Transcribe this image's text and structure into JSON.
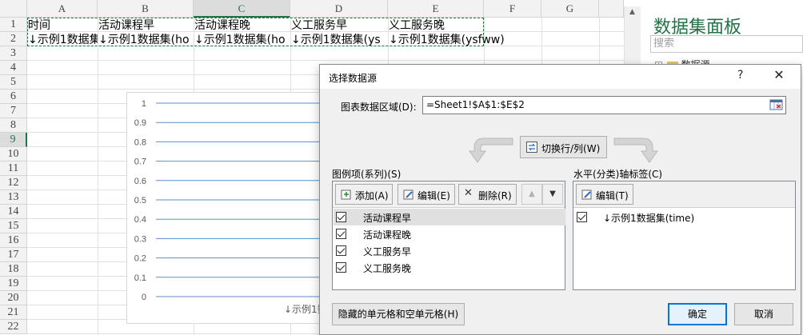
{
  "spreadsheet": {
    "columns": [
      "A",
      "B",
      "C",
      "D",
      "E",
      "F",
      "G"
    ],
    "selected_column": "C",
    "rows": [
      "1",
      "2",
      "3",
      "4",
      "5",
      "6",
      "7",
      "8",
      "9",
      "10",
      "11",
      "12",
      "13",
      "14",
      "15",
      "16",
      "17",
      "18",
      "19",
      "20",
      "21",
      "22"
    ],
    "selected_row": "9",
    "row1": [
      "时间",
      "活动课程早",
      "活动课程晚",
      "义工服务早",
      "义工服务晚"
    ],
    "row2": [
      "↓示例1数据集",
      "↓示例1数据集(ho",
      "↓示例1数据集(ho",
      "↓示例1数据集(ys",
      "↓示例1数据集(ysfww)"
    ]
  },
  "chart": {
    "y_ticks": [
      "1",
      "0.9",
      "0.8",
      "0.7",
      "0.6",
      "0.5",
      "0.4",
      "0.3",
      "0.2",
      "0.1",
      "0"
    ],
    "x_label": "↓示例1数",
    "gridline_color": "#5b8fc7"
  },
  "chart_data": {
    "type": "line",
    "ylim": [
      0,
      1
    ],
    "categories": [
      "↓示例1数"
    ],
    "series": []
  },
  "right_pane": {
    "title": "数据集面板",
    "search_placeholder": "搜索",
    "tree_item": "数据源",
    "accent": "#217346"
  },
  "dialog": {
    "title": "选择数据源",
    "help": "?",
    "close": "✕",
    "range_label": "图表数据区域(D):",
    "range_value": "=Sheet1!$A$1:$E$2",
    "switch_label": "切换行/列(W)",
    "legend_label": "图例项(系列)(S)",
    "axis_label": "水平(分类)轴标签(C)",
    "add_label": "添加(A)",
    "edit_label": "编辑(E)",
    "delete_label": "删除(R)",
    "axis_edit_label": "编辑(T)",
    "series": [
      {
        "name": "活动课程早",
        "checked": true
      },
      {
        "name": "活动课程晚",
        "checked": true
      },
      {
        "name": "义工服务早",
        "checked": true
      },
      {
        "name": "义工服务晚",
        "checked": true
      }
    ],
    "axis_items": [
      {
        "name": "↓示例1数据集(time)",
        "checked": true
      }
    ],
    "hidden_cells_label": "隐藏的单元格和空单元格(H)",
    "ok_label": "确定",
    "cancel_label": "取消",
    "ok_border_color": "#0078d7"
  }
}
